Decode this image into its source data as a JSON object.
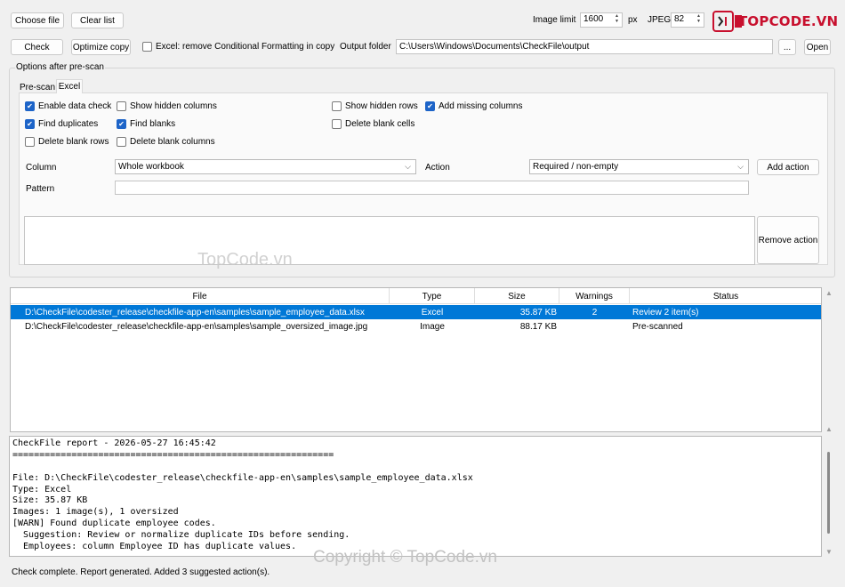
{
  "toolbar": {
    "choose_file": "Choose file",
    "clear_list": "Clear list",
    "image_limit_label": "Image limit",
    "image_limit_value": "1600",
    "px_label": "px",
    "jpeg_label": "JPEG",
    "jpeg_value": "82",
    "check": "Check",
    "optimize_copy": "Optimize copy",
    "remove_cf_label": "Excel: remove Conditional Formatting in copy",
    "output_folder_label": "Output folder",
    "output_folder_value": "C:\\Users\\Windows\\Documents\\CheckFile\\output",
    "browse": "...",
    "open": "Open"
  },
  "logo": {
    "text": "TOPCODE.VN",
    "brand_color": "#c8102e"
  },
  "options": {
    "group_title": "Options after pre-scan",
    "tabs": [
      "Pre-scan",
      "Excel"
    ],
    "active_tab": "Excel",
    "checkboxes": {
      "enable_data_check": {
        "label": "Enable data check",
        "checked": true
      },
      "show_hidden_columns": {
        "label": "Show hidden columns",
        "checked": false
      },
      "show_hidden_rows": {
        "label": "Show hidden rows",
        "checked": false
      },
      "add_missing_columns": {
        "label": "Add missing columns",
        "checked": true
      },
      "find_duplicates": {
        "label": "Find duplicates",
        "checked": true
      },
      "find_blanks": {
        "label": "Find blanks",
        "checked": true
      },
      "delete_blank_cells": {
        "label": "Delete blank cells",
        "checked": false
      },
      "delete_blank_rows": {
        "label": "Delete blank rows",
        "checked": false
      },
      "delete_blank_columns": {
        "label": "Delete blank columns",
        "checked": false
      }
    },
    "column_label": "Column",
    "column_value": "Whole workbook",
    "action_label": "Action",
    "action_value": "Required / non-empty",
    "add_action": "Add action",
    "pattern_label": "Pattern",
    "pattern_value": "",
    "remove_action": "Remove action"
  },
  "files": {
    "headers": [
      "File",
      "Type",
      "Size",
      "Warnings",
      "Status"
    ],
    "rows": [
      {
        "file": "D:\\CheckFile\\codester_release\\checkfile-app-en\\samples\\sample_employee_data.xlsx",
        "type": "Excel",
        "size": "35.87 KB",
        "warnings": "2",
        "status": "Review 2 item(s)",
        "selected": true
      },
      {
        "file": "D:\\CheckFile\\codester_release\\checkfile-app-en\\samples\\sample_oversized_image.jpg",
        "type": "Image",
        "size": "88.17 KB",
        "warnings": "",
        "status": "Pre-scanned",
        "selected": false
      }
    ]
  },
  "report": {
    "lines": [
      "CheckFile report - 2026-05-27 16:45:42",
      "============================================================",
      "",
      "File: D:\\CheckFile\\codester_release\\checkfile-app-en\\samples\\sample_employee_data.xlsx",
      "Type: Excel",
      "Size: 35.87 KB",
      "Images: 1 image(s), 1 oversized",
      "[WARN] Found duplicate employee codes.",
      "  Suggestion: Review or normalize duplicate IDs before sending.",
      "  Employees: column Employee ID has duplicate values."
    ]
  },
  "status_bar": "Check complete. Report generated. Added 3 suggested action(s).",
  "watermarks": {
    "center": "TopCode.vn",
    "bottom": "Copyright © TopCode.vn"
  },
  "colors": {
    "selection": "#0078d7",
    "checkbox_on": "#1d64c8"
  }
}
